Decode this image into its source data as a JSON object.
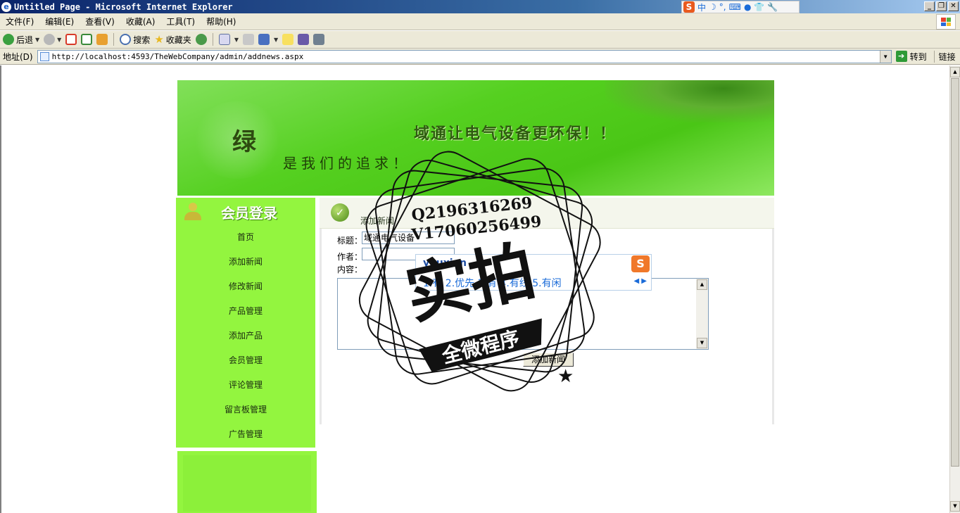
{
  "window": {
    "title": "Untitled Page - Microsoft Internet Explorer"
  },
  "ime_bar": {
    "logo": "S",
    "mode": "中",
    "symbols": [
      "☽",
      "°,",
      "⌨",
      "●",
      "👕",
      "🔧"
    ]
  },
  "menu": {
    "items": [
      "文件(F)",
      "编辑(E)",
      "查看(V)",
      "收藏(A)",
      "工具(T)",
      "帮助(H)"
    ]
  },
  "toolbar": {
    "back": "后退",
    "search": "搜索",
    "favorites": "收藏夹"
  },
  "address": {
    "label": "地址(D)",
    "url": "http://localhost:4593/TheWebCompany/admin/addnews.aspx",
    "go": "转到",
    "links": "链接"
  },
  "banner": {
    "logo_glyph": "绿",
    "slogan1": "域通让电气设备更环保！！",
    "slogan2": "是我们的追求！"
  },
  "sidebar": {
    "title": "会员登录",
    "items": [
      "首页",
      "添加新闻",
      "修改新闻",
      "产品管理",
      "添加产品",
      "会员管理",
      "评论管理",
      "留言板管理",
      "广告管理"
    ]
  },
  "content": {
    "heading": "添加新闻",
    "title_label": "标题：",
    "title_value": "域通电气设备",
    "author_label": "作者：",
    "author_value": "",
    "content_label": "内容：",
    "submit": "添加新闻"
  },
  "ime_popup": {
    "pinyin": "youxian",
    "candidates": "1.有 2.优先 3.有 4.有线 5.有闲",
    "logo": "S"
  },
  "watermark": {
    "qq": "Q2196316269",
    "wechat": "V17060256499",
    "main": "实拍",
    "banner": "全微程序"
  },
  "colors": {
    "sidebar_green": "#93f53f",
    "banner_green": "#55d020",
    "titlebar_blue": "#0a246a"
  }
}
